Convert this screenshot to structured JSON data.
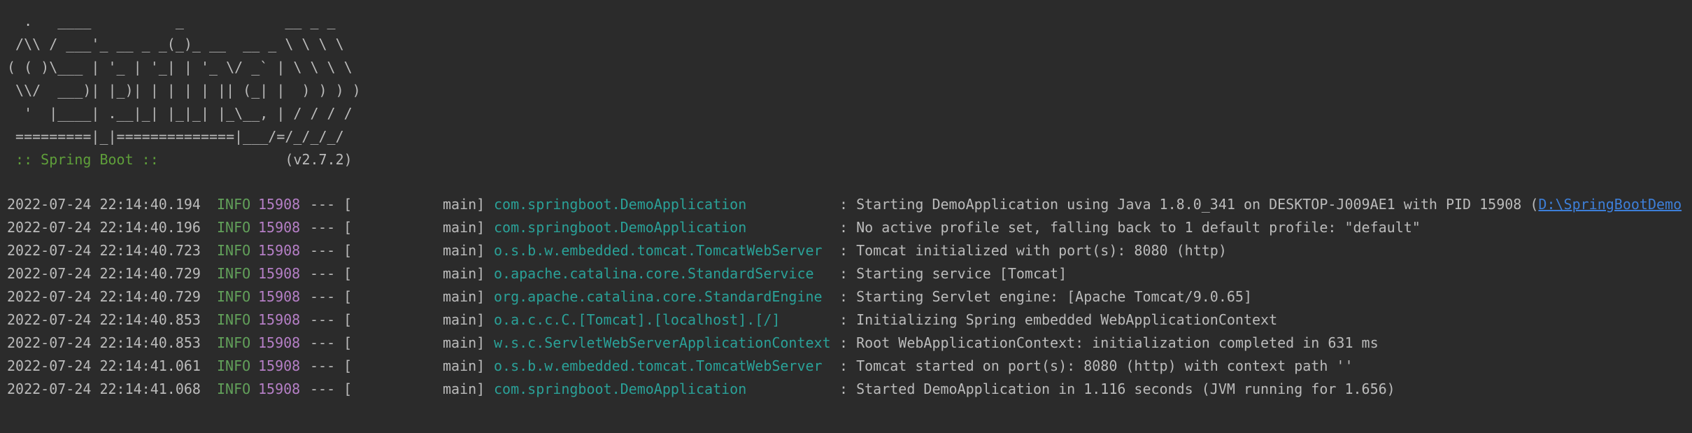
{
  "banner": [
    "  .   ____          _            __ _ _",
    " /\\\\ / ___'_ __ _ _(_)_ __  __ _ \\ \\ \\ \\",
    "( ( )\\___ | '_ | '_| | '_ \\/ _` | \\ \\ \\ \\",
    " \\\\/  ___)| |_)| | | | | || (_| |  ) ) ) )",
    "  '  |____| .__|_| |_|_| |_\\__, | / / / /",
    " =========|_|==============|___/=/_/_/_/"
  ],
  "boot": {
    "label": " :: Spring Boot :: ",
    "version": "              (v2.7.2)"
  },
  "log": [
    {
      "timestamp": "2022-07-24 22:14:40.194",
      "level": "INFO",
      "pid": "15908",
      "separator": "--- [",
      "thread": "main]",
      "logger": "com.springboot.DemoApplication",
      "message": ": Starting DemoApplication using Java 1.8.0_341 on DESKTOP-J009AE1 with PID 15908 (",
      "link": "D:\\SpringBootDemo"
    },
    {
      "timestamp": "2022-07-24 22:14:40.196",
      "level": "INFO",
      "pid": "15908",
      "separator": "--- [",
      "thread": "main]",
      "logger": "com.springboot.DemoApplication",
      "message": ": No active profile set, falling back to 1 default profile: \"default\""
    },
    {
      "timestamp": "2022-07-24 22:14:40.723",
      "level": "INFO",
      "pid": "15908",
      "separator": "--- [",
      "thread": "main]",
      "logger": "o.s.b.w.embedded.tomcat.TomcatWebServer",
      "message": ": Tomcat initialized with port(s): 8080 (http)"
    },
    {
      "timestamp": "2022-07-24 22:14:40.729",
      "level": "INFO",
      "pid": "15908",
      "separator": "--- [",
      "thread": "main]",
      "logger": "o.apache.catalina.core.StandardService",
      "message": ": Starting service [Tomcat]"
    },
    {
      "timestamp": "2022-07-24 22:14:40.729",
      "level": "INFO",
      "pid": "15908",
      "separator": "--- [",
      "thread": "main]",
      "logger": "org.apache.catalina.core.StandardEngine",
      "message": ": Starting Servlet engine: [Apache Tomcat/9.0.65]"
    },
    {
      "timestamp": "2022-07-24 22:14:40.853",
      "level": "INFO",
      "pid": "15908",
      "separator": "--- [",
      "thread": "main]",
      "logger": "o.a.c.c.C.[Tomcat].[localhost].[/]",
      "message": ": Initializing Spring embedded WebApplicationContext"
    },
    {
      "timestamp": "2022-07-24 22:14:40.853",
      "level": "INFO",
      "pid": "15908",
      "separator": "--- [",
      "thread": "main]",
      "logger": "w.s.c.ServletWebServerApplicationContext",
      "message": ": Root WebApplicationContext: initialization completed in 631 ms"
    },
    {
      "timestamp": "2022-07-24 22:14:41.061",
      "level": "INFO",
      "pid": "15908",
      "separator": "--- [",
      "thread": "main]",
      "logger": "o.s.b.w.embedded.tomcat.TomcatWebServer",
      "message": ": Tomcat started on port(s): 8080 (http) with context path ''"
    },
    {
      "timestamp": "2022-07-24 22:14:41.068",
      "level": "INFO",
      "pid": "15908",
      "separator": "--- [",
      "thread": "main]",
      "logger": "com.springboot.DemoApplication",
      "message": ": Started DemoApplication in 1.116 seconds (JVM running for 1.656)"
    }
  ],
  "colors": {
    "background": "#2b2b2b",
    "text": "#bbbbbb",
    "level_info": "#62a05a",
    "pid": "#b57fc6",
    "logger": "#2aa198",
    "link": "#3d7fd9",
    "boot_label": "#5f9f3a"
  }
}
